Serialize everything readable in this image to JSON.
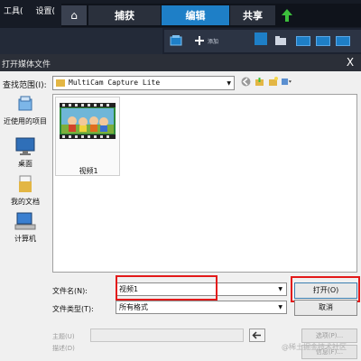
{
  "app_menu": {
    "tools": "工具(",
    "settings": "设置("
  },
  "nav_tabs": {
    "capture": "捕获",
    "edit": "编辑",
    "share": "共享"
  },
  "toolbar": {
    "add_label": "添加"
  },
  "dialog": {
    "title": "打开媒体文件",
    "close": "X",
    "look_in_label": "查找范围(I):",
    "look_in_value": "MultiCam Capture Lite",
    "places": [
      "近使用的项目",
      "桌面",
      "我的文档",
      "计算机"
    ],
    "files": [
      {
        "name": "视频1"
      }
    ],
    "filename_label": "文件名(N):",
    "filename_value": "视频1",
    "filetype_label": "文件类型(T):",
    "filetype_value": "所有格式",
    "open_button": "打开(O)",
    "cancel_button": "取消",
    "subject_label": "主题(U)",
    "description_label": "描述(D)",
    "options_button": "选项(P)...",
    "info_button": "信息(F)..."
  },
  "watermark": "@稀土掘金技术社区",
  "colors": {
    "accent": "#1e7fc7",
    "highlight": "#e31a1a",
    "appbar": "#161b25"
  }
}
